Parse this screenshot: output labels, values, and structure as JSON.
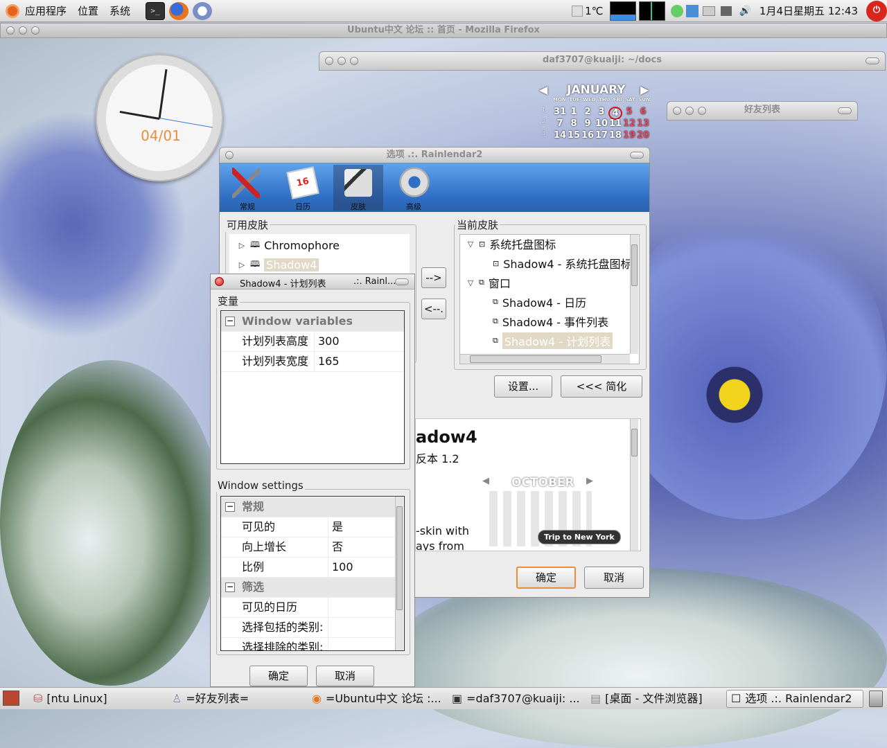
{
  "top_panel": {
    "menus": [
      "应用程序",
      "位置",
      "系统"
    ],
    "weather": "1℃",
    "datetime": "1月4日星期五 12:43"
  },
  "firefox_window": {
    "title": "Ubuntu中文 论坛 :: 首页 - Mozilla Firefox"
  },
  "terminal_window": {
    "title": "daf3707@kuaiji: ~/docs"
  },
  "friends_window": {
    "title": "好友列表"
  },
  "clock": {
    "date": "04/01"
  },
  "calendar_widget": {
    "month": "JANUARY",
    "weekdays": [
      "MON",
      "TUE",
      "WED",
      "THU",
      "FRI",
      "SAT",
      "SUN"
    ],
    "weeks": [
      {
        "wk": "1",
        "days": [
          "31",
          "1",
          "2",
          "3",
          "4",
          "5",
          "6"
        ]
      },
      {
        "wk": "2",
        "days": [
          "7",
          "8",
          "9",
          "10",
          "11",
          "12",
          "13"
        ]
      },
      {
        "wk": "3",
        "days": [
          "14",
          "15",
          "16",
          "17",
          "18",
          "19",
          "20"
        ]
      }
    ]
  },
  "options_dialog": {
    "title": "选项 .:. Rainlendar2",
    "tabs": [
      "常规",
      "日历",
      "皮肤",
      "高级"
    ],
    "available_skins_label": "可用皮肤",
    "available_skins": [
      "Chromophore",
      "Shadow4"
    ],
    "current_skin_label": "当前皮肤",
    "current_skin_tree": [
      {
        "label": "系统托盘图标",
        "level": 0
      },
      {
        "label": "Shadow4 - 系统托盘图标",
        "level": 1
      },
      {
        "label": "窗口",
        "level": 0
      },
      {
        "label": "Shadow4 - 日历",
        "level": 1
      },
      {
        "label": "Shadow4 - 事件列表",
        "level": 1
      },
      {
        "label": "Shadow4 - 计划列表",
        "level": 1
      }
    ],
    "arrow_add": "-->",
    "arrow_remove": "<--.",
    "settings_button": "设置...",
    "simplify_button": "<<< 简化",
    "preview_title": "adow4",
    "preview_version": "反本 1.2",
    "preview_text1": "-skin with",
    "preview_text2": "ays from",
    "preview_month": "OCTOBER",
    "preview_event": "Trip to New York",
    "ok_button": "确定",
    "cancel_button": "取消"
  },
  "subdialog": {
    "title": "Shadow4 - 计划列表",
    "title_suffix": ".:. Rainl...",
    "variables_label": "变量",
    "variables_header": "Window variables",
    "variables": [
      {
        "key": "计划列表高度",
        "value": "300"
      },
      {
        "key": "计划列表宽度",
        "value": "165"
      }
    ],
    "window_settings_label": "Window settings",
    "general_header": "常规",
    "general": [
      {
        "key": "可见的",
        "value": "是"
      },
      {
        "key": "向上增长",
        "value": "否"
      },
      {
        "key": "比例",
        "value": "100"
      }
    ],
    "filter_header": "筛选",
    "filter": [
      {
        "key": "可见的日历",
        "value": ""
      },
      {
        "key": "选择包括的类别:",
        "value": ""
      },
      {
        "key": "选择排除的类别:",
        "value": ""
      }
    ],
    "ok_button": "确定",
    "cancel_button": "取消"
  },
  "taskbar": {
    "tasks": [
      "[ntu Linux]",
      "=好友列表=",
      "=Ubuntu中文 论坛 :...",
      "=daf3707@kuaiji: ...",
      "[桌面 - 文件浏览器]",
      "选项 .:. Rainlendar2"
    ]
  },
  "colors": {
    "accent_orange": "#e98d3b",
    "tab_bar_blue": "#2f6fc4",
    "desktop_violet": "#5a66b0"
  }
}
